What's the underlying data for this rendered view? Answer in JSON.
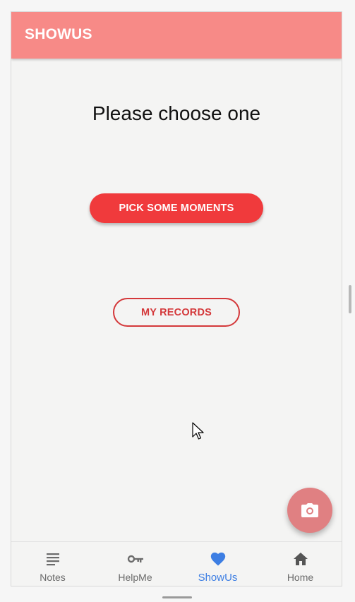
{
  "appbar": {
    "title": "SHOWUS"
  },
  "main": {
    "prompt": "Please choose one",
    "primary_button": "PICK SOME MOMENTS",
    "secondary_button": "MY RECORDS"
  },
  "fab": {
    "icon": "camera-icon"
  },
  "bottom_nav": {
    "items": [
      {
        "label": "Notes",
        "icon": "notes-icon"
      },
      {
        "label": "HelpMe",
        "icon": "key-icon"
      },
      {
        "label": "ShowUs",
        "icon": "heart-icon",
        "active": true
      },
      {
        "label": "Home",
        "icon": "home-icon"
      }
    ]
  },
  "colors": {
    "appbar": "#f78a87",
    "primary": "#f03a3c",
    "outline": "#d4383a",
    "fab": "#e08082",
    "active_nav": "#3d7ee3"
  }
}
